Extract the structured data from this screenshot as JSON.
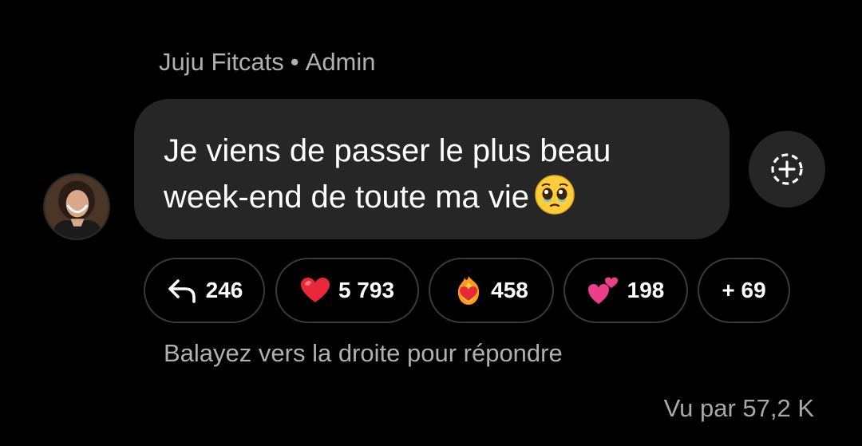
{
  "message": {
    "sender_name": "Juju Fitcats",
    "separator": "•",
    "sender_role": "Admin",
    "text_line1": "Je viens de passer le plus beau",
    "text_line2": "week-end de toute ma vie",
    "emoji_icon": "pleading-face-icon"
  },
  "add_reaction_icon": "add-reaction-icon",
  "reactions": [
    {
      "icon": "reply-arrow-icon",
      "count": "246"
    },
    {
      "icon": "red-heart-icon",
      "count": "5 793"
    },
    {
      "icon": "heart-on-fire-icon",
      "count": "458"
    },
    {
      "icon": "two-hearts-icon",
      "count": "198"
    },
    {
      "icon": "",
      "count": "+ 69"
    }
  ],
  "hint": "Balayez vers la droite pour répondre",
  "seen_by": "Vu par 57,2 K",
  "colors": {
    "background": "#000000",
    "bubble": "#262626",
    "chip_border": "#3a3a3a",
    "secondary_text": "#b0b0b0",
    "heart_red": "#e8283a",
    "heart_pink": "#ec3f8a"
  }
}
